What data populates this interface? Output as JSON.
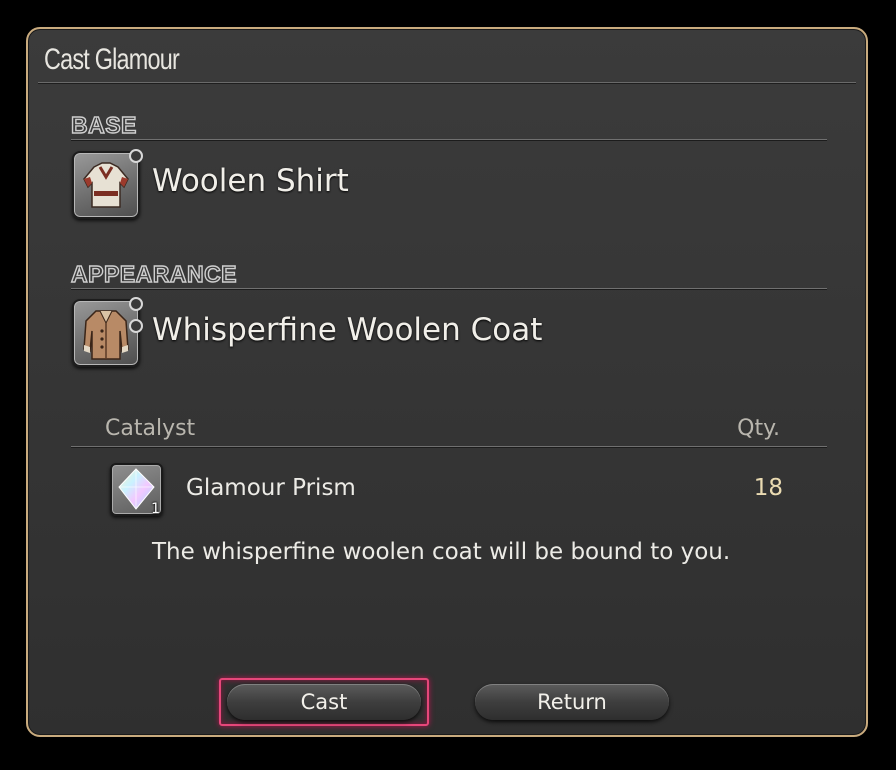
{
  "window": {
    "title": "Cast Glamour"
  },
  "base": {
    "label": "BASE",
    "item_name": "Woolen Shirt",
    "icon": "woolen-shirt-icon"
  },
  "appearance": {
    "label": "APPEARANCE",
    "item_name": "Whisperfine Woolen Coat",
    "icon": "woolen-coat-icon"
  },
  "catalyst": {
    "header_label": "Catalyst",
    "qty_header": "Qty.",
    "item_name": "Glamour Prism",
    "icon": "glamour-prism-icon",
    "stack_count": "1",
    "quantity": "18"
  },
  "message": "The whisperfine woolen coat will be bound to you.",
  "buttons": {
    "cast_label": "Cast",
    "return_label": "Return"
  },
  "colors": {
    "frame": "#c9ab7e",
    "focus": "#e6477a",
    "quantity_text": "#eadbb2"
  }
}
